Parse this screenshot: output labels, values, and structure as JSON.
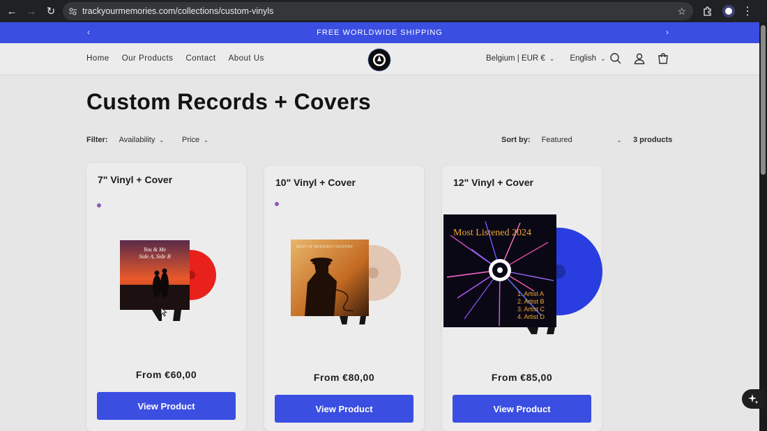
{
  "browser": {
    "url": "trackyourmemories.com/collections/custom-vinyls"
  },
  "announcement": {
    "text": "FREE WORLDWIDE SHIPPING"
  },
  "nav": {
    "items": [
      "Home",
      "Our Products",
      "Contact",
      "About Us"
    ]
  },
  "locale": {
    "country": "Belgium | EUR €",
    "language": "English"
  },
  "page": {
    "title": "Custom Records + Covers"
  },
  "filters": {
    "label": "Filter:",
    "availability": "Availability",
    "price": "Price"
  },
  "sort": {
    "label": "Sort by:",
    "value": "Featured",
    "count": "3 products"
  },
  "products": [
    {
      "title": "7\" Vinyl + Cover",
      "price": "From €60,00",
      "button": "View Product",
      "cover_text": "You & Me\nSide A, Side B",
      "vinyl_color": "#e8211c"
    },
    {
      "title": "10\" Vinyl + Cover",
      "price": "From €80,00",
      "button": "View Product",
      "cover_text": "BEST OF MODERN COUNTRY",
      "vinyl_color": "#e2c7b4"
    },
    {
      "title": "12\" Vinyl + Cover",
      "price": "From €85,00",
      "button": "View Product",
      "cover_text": "Most Listened 2024",
      "tracklist": [
        "1.  Artist A",
        "2.  Artist B",
        "3.  Artist C",
        "4.  Artist D"
      ],
      "vinyl_color": "#2a3de0"
    }
  ],
  "colors": {
    "accent": "#3b4ee2",
    "background": "#e6e6e6"
  }
}
